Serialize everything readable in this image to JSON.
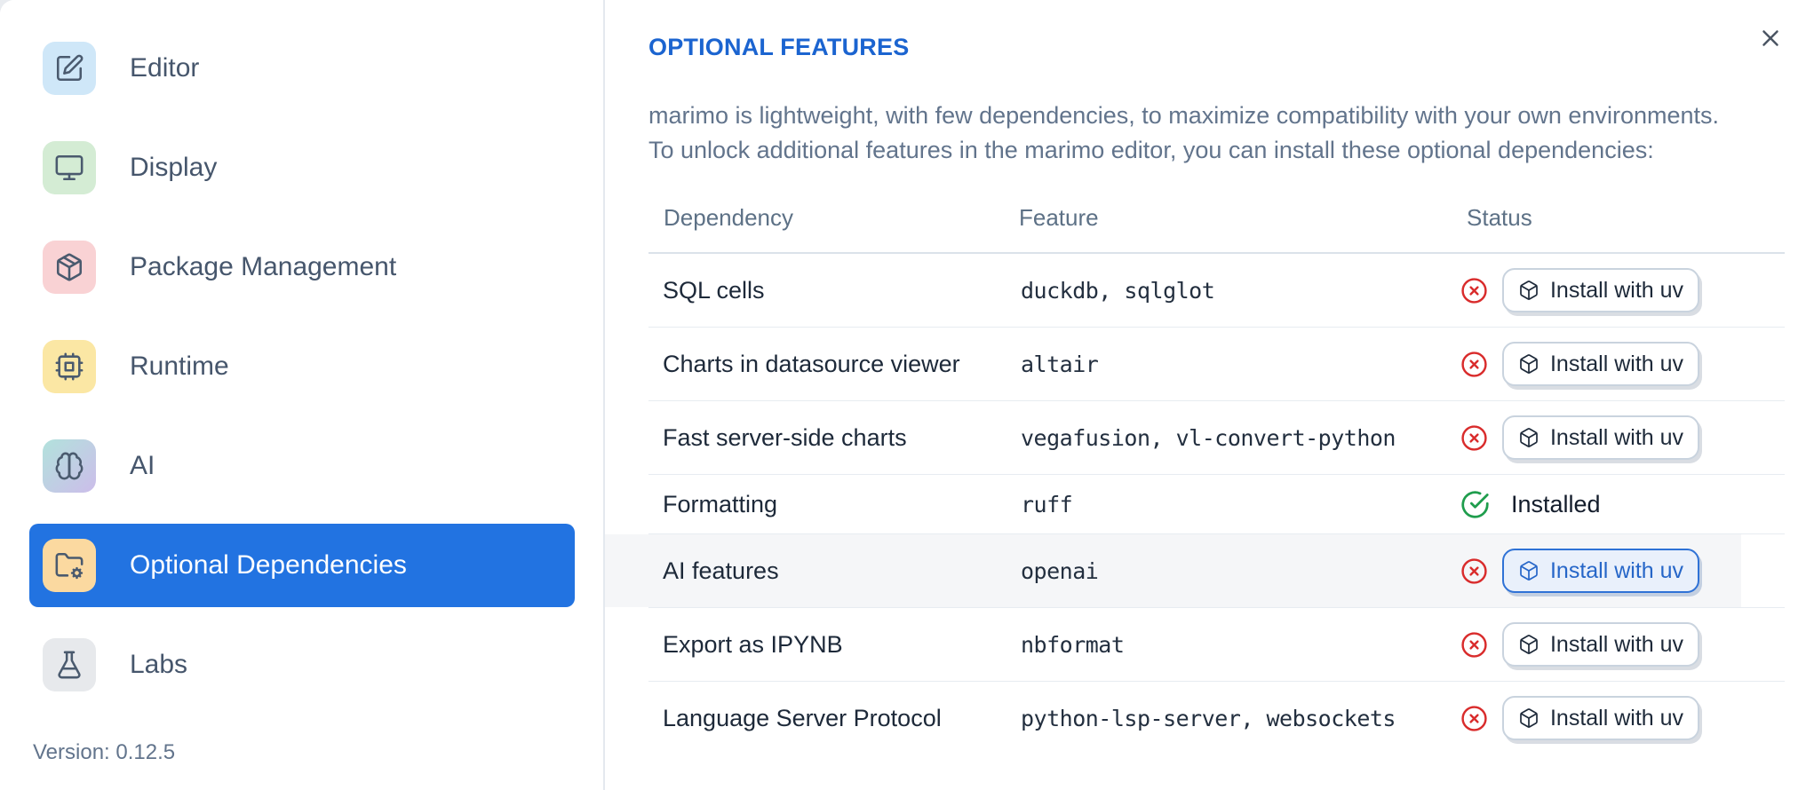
{
  "colors": {
    "accent": "#2273e1",
    "title": "#1b64d0",
    "danger": "#d92c2c",
    "success": "#1f9d4d",
    "ink": "#1d2939",
    "mono_ink": "#232f3f",
    "muted": "#62748c",
    "header": "#5d7186",
    "sidebar_label": "#46566c",
    "divider": "#e4e9ef",
    "row_border": "#e7ecf1",
    "button_border": "#c9d3de",
    "ai_button_bg": "#e9f0fb",
    "ai_button_border": "#2f72d6",
    "ai_button_text": "#2666c8",
    "highlight": "#f5f6f8"
  },
  "sidebar": {
    "items": [
      {
        "label": "Editor",
        "icon": "edit-icon",
        "icon_bg": "#cfe7f8"
      },
      {
        "label": "Display",
        "icon": "monitor-icon",
        "icon_bg": "#d4ecd4"
      },
      {
        "label": "Package Management",
        "icon": "package-icon",
        "icon_bg": "#f9d2d4"
      },
      {
        "label": "Runtime",
        "icon": "cpu-icon",
        "icon_bg": "#fbe7a4"
      },
      {
        "label": "AI",
        "icon": "brain-icon",
        "icon_bg": "linear-gradient(135deg,#b2e2dc,#ccbdea)"
      },
      {
        "label": "Optional Dependencies",
        "icon": "folder-cog-icon",
        "icon_bg": "#fbd9a0",
        "selected": true
      },
      {
        "label": "Labs",
        "icon": "flask-icon",
        "icon_bg": "#e7e9ec"
      }
    ],
    "version_label": "Version: 0.12.5"
  },
  "dialog": {
    "title": "OPTIONAL FEATURES",
    "description": [
      "marimo is lightweight, with few dependencies, to maximize compatibility with your own environments.",
      "To unlock additional features in the marimo editor, you can install these optional dependencies:"
    ],
    "close_icon": "close-icon"
  },
  "table": {
    "headers": [
      "Dependency",
      "Feature",
      "Status"
    ],
    "status_icons": {
      "missing": "circle-x-icon",
      "installed": "circle-check-icon"
    },
    "button_icon": "package-cube-icon",
    "rows": [
      {
        "dependency": "SQL cells",
        "feature": "duckdb, sqlglot",
        "status": "missing",
        "action": "Install with uv"
      },
      {
        "dependency": "Charts in datasource viewer",
        "feature": "altair",
        "status": "missing",
        "action": "Install with uv"
      },
      {
        "dependency": "Fast server-side charts",
        "feature": "vegafusion, vl-convert-python",
        "status": "missing",
        "action": "Install with uv"
      },
      {
        "dependency": "Formatting",
        "feature": "ruff",
        "status": "installed",
        "status_label": "Installed"
      },
      {
        "dependency": "AI features",
        "feature": "openai",
        "status": "missing",
        "action": "Install with uv",
        "highlighted": true
      },
      {
        "dependency": "Export as IPYNB",
        "feature": "nbformat",
        "status": "missing",
        "action": "Install with uv"
      },
      {
        "dependency": "Language Server Protocol",
        "feature": "python-lsp-server, websockets",
        "status": "missing",
        "action": "Install with uv"
      }
    ]
  }
}
